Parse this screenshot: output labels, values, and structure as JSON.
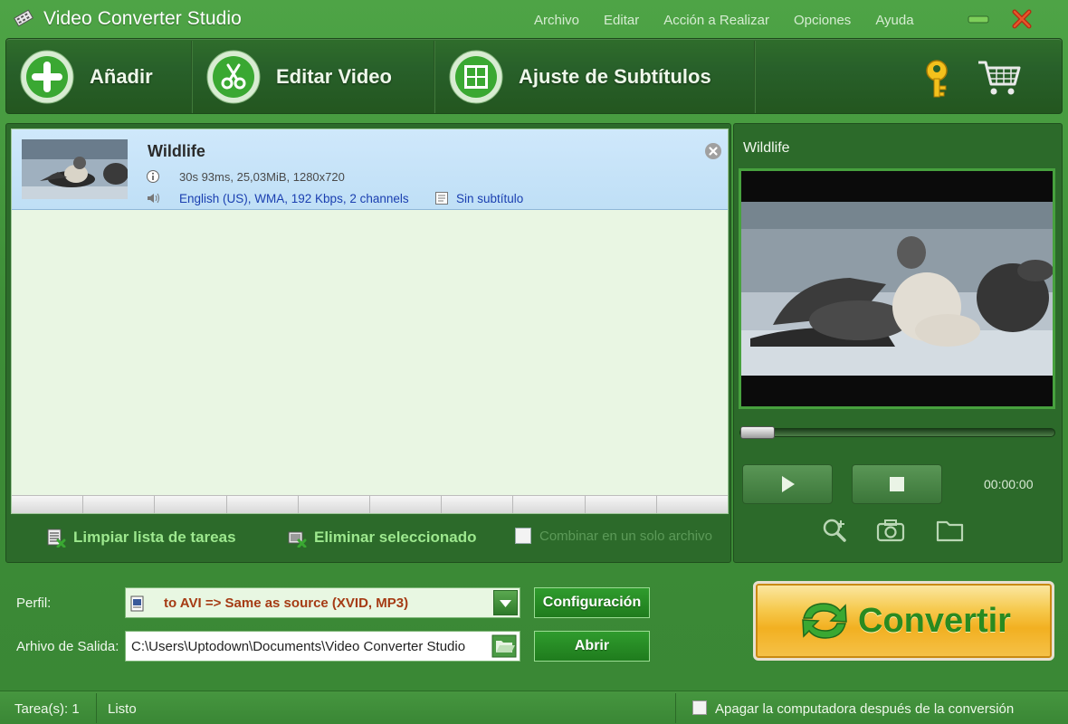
{
  "window": {
    "title": "Video Converter Studio",
    "menu": [
      "Archivo",
      "Editar",
      "Acción a Realizar",
      "Opciones",
      "Ayuda"
    ]
  },
  "toolbar": {
    "add_label": "Añadir",
    "edit_label": "Editar Video",
    "subtitles_label": "Ajuste de Subtítulos"
  },
  "tasks": [
    {
      "title": "Wildlife",
      "info": "30s 93ms, 25,03MiB, 1280x720",
      "audio": "English (US), WMA, 192 Kbps, 2 channels",
      "subtitle": "Sin subtítulo"
    }
  ],
  "list_actions": {
    "clear_label": "Limpiar lista de tareas",
    "remove_label": "Eliminar seleccionado",
    "merge_label": "Combinar en un solo archivo"
  },
  "preview": {
    "title": "Wildlife",
    "time": "00:00:00",
    "progress": 0
  },
  "output": {
    "profile_label": "Perfil:",
    "profile_value": "to AVI => Same as source (XVID, MP3)",
    "settings_button": "Configuración",
    "output_label": "Arhivo de Salida:",
    "output_path": "C:\\Users\\Uptodown\\Documents\\Video Converter Studio",
    "open_button": "Abrir",
    "convert_button": "Convertir"
  },
  "status": {
    "tasks": "Tarea(s): 1",
    "state": "Listo",
    "shutdown_label": "Apagar la computadora después de la conversión"
  },
  "colors": {
    "window_green": "#3f8a3a",
    "toolbar_dark": "#28602a",
    "list_bg": "#e9f6e3",
    "selected_row": "#cfe8fb",
    "link_blue": "#1a3fb0",
    "profile_text": "#a53b14",
    "convert_orange": "#f2b021"
  }
}
